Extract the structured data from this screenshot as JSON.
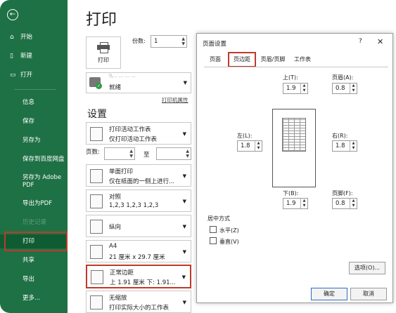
{
  "sidebar": {
    "items": [
      {
        "icon": "home",
        "label": "开始"
      },
      {
        "icon": "new",
        "label": "新建"
      },
      {
        "icon": "open",
        "label": "打开"
      },
      {
        "label": "信息"
      },
      {
        "label": "保存"
      },
      {
        "label": "另存为"
      },
      {
        "label": "保存到百度网盘"
      },
      {
        "label": "另存为 Adobe PDF"
      },
      {
        "label": "导出为PDF"
      },
      {
        "label": "历史记录"
      },
      {
        "label": "打印"
      },
      {
        "label": "共享"
      },
      {
        "label": "导出"
      },
      {
        "label": "更多..."
      }
    ]
  },
  "print": {
    "title": "打印",
    "print_button": "打印",
    "copies_label": "份数:",
    "copies_value": "1",
    "printer_name": "\\\\... ... ... ...",
    "printer_status": "就绪",
    "printer_props": "打印机属性",
    "settings_title": "设置",
    "options": [
      {
        "line1": "打印活动工作表",
        "line2": "仅打印活动工作表"
      },
      {
        "line1": "单面打印",
        "line2": "仅在纸面的一侧上进行..."
      },
      {
        "line1": "对照",
        "line2": "1,2,3    1,2,3    1,2,3"
      },
      {
        "line1": "纵向",
        "line2": ""
      },
      {
        "line1": "A4",
        "line2": "21 厘米 x 29.7 厘米"
      },
      {
        "line1": "正常边距",
        "line2": "上 1.91 厘米 下: 1.91..."
      },
      {
        "line1": "无缩放",
        "line2": "打印实际大小的工作表"
      }
    ],
    "pages_label": "页数:",
    "pages_to": "至"
  },
  "dialog": {
    "title": "页面设置",
    "help": "?",
    "close": "✕",
    "tabs": [
      "页面",
      "页边距",
      "页眉/页脚",
      "工作表"
    ],
    "active_tab": "页边距",
    "top_label": "上(T):",
    "top_value": "1.9",
    "header_label": "页眉(A):",
    "header_value": "0.8",
    "left_label": "左(L):",
    "left_value": "1.8",
    "right_label": "右(R):",
    "right_value": "1.8",
    "bottom_label": "下(B):",
    "bottom_value": "1.9",
    "footer_label": "页脚(F):",
    "footer_value": "0.8",
    "center_title": "居中方式",
    "horizontal": "水平(Z)",
    "vertical": "垂直(V)",
    "options_btn": "选项(O)...",
    "ok_btn": "确定",
    "cancel_btn": "取消"
  },
  "colors": {
    "sidebar": "#1e7145",
    "highlight": "#c0392b",
    "accent": "#2b6fc4"
  }
}
